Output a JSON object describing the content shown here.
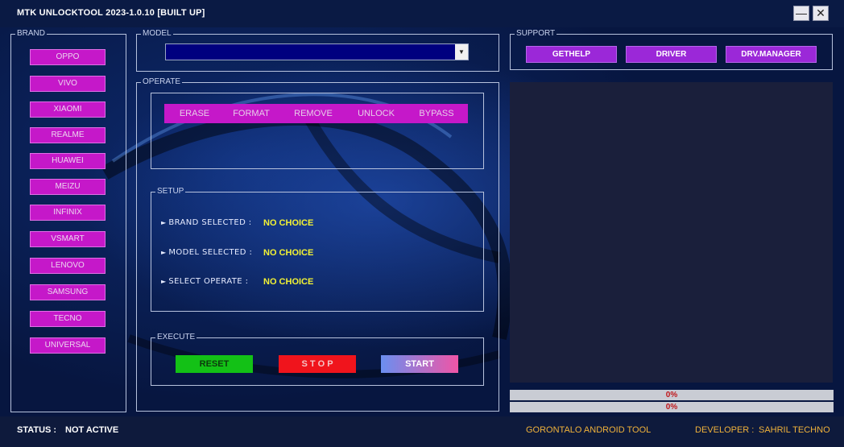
{
  "window": {
    "title": "MTK UNLOCKTOOL 2023-1.0.10   [BUILT UP]",
    "minimize_glyph": "—",
    "close_glyph": "✕"
  },
  "brand": {
    "legend": "BRAND",
    "items": [
      "OPPO",
      "VIVO",
      "XIAOMI",
      "REALME",
      "HUAWEI",
      "MEIZU",
      "INFINIX",
      "VSMART",
      "LENOVO",
      "SAMSUNG",
      "TECNO",
      "UNIVERSAL"
    ]
  },
  "model": {
    "legend": "MODEL",
    "selected": "",
    "arrow_icon": "▼"
  },
  "operate": {
    "legend": "OPERATE",
    "buttons": [
      "ERASE",
      "FORMAT",
      "REMOVE",
      "UNLOCK",
      "BYPASS"
    ]
  },
  "setup": {
    "legend": "SETUP",
    "rows": [
      {
        "label": "BRAND SELECTED :",
        "value": "NO CHOICE"
      },
      {
        "label": "MODEL SELECTED :",
        "value": "NO CHOICE"
      },
      {
        "label": "SELECT OPERATE :",
        "value": "NO CHOICE"
      }
    ],
    "bullet": "►"
  },
  "execute": {
    "legend": "EXECUTE",
    "reset": "RESET",
    "stop": "S T O P",
    "start": "START"
  },
  "support": {
    "legend": "SUPPORT",
    "buttons": [
      "GETHELP",
      "DRIVER",
      "DRV.MANAGER"
    ]
  },
  "progress": [
    "0%",
    "0%"
  ],
  "status": {
    "label": "STATUS :",
    "value": "NOT ACTIVE",
    "center": "GORONTALO ANDROID TOOL",
    "developer_label": "DEVELOPER :",
    "developer": "SAHRIL TECHNO"
  },
  "colors": {
    "brand_button": "#c518c9",
    "support_button": "#9b28d8",
    "reset": "#13c116",
    "stop": "#f0141c",
    "start_from": "#6a8ff0",
    "start_to": "#f055a6",
    "setup_value": "#f2f234",
    "footer_text": "#f0b23a"
  }
}
